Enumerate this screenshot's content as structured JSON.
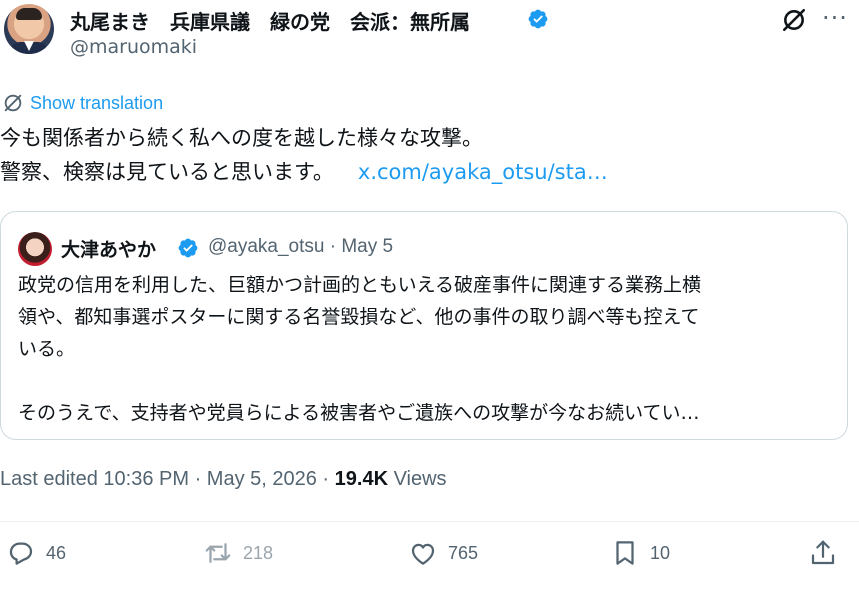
{
  "author": {
    "name": "丸尾まき　兵庫県議　緑の党　会派：無所属",
    "handle": "@maruomaki"
  },
  "translate_label": "Show translation",
  "tweet": {
    "line1": "今も関係者から続く私への度を越した様々な攻撃。",
    "line2": "警察、検察は見ていると思います。",
    "link": "x.com/ayaka_otsu/sta…"
  },
  "quote": {
    "name": "大津あやか",
    "handle": "@ayaka_otsu",
    "separator": "·",
    "date": "May 5",
    "lines": [
      "政党の信用を利用した、巨額かつ計画的ともいえる破産事件に関連する業務上横",
      "領や、都知事選ポスターに関する名誉毀損など、他の事件の取り調べ等も控えて",
      "いる。",
      "",
      "そのうえで、支持者や党員らによる被害者やご遺族への攻撃が今なお続いてい…"
    ]
  },
  "meta": {
    "edited": "Last edited 10:36 PM · May 5, 2026 · ",
    "views_count": "19.4K",
    "views_label": " Views"
  },
  "actions": {
    "replies": "46",
    "reposts": "218",
    "likes": "765",
    "bookmarks": "10"
  },
  "colors": {
    "accent": "#1d9bf0",
    "text": "#0f1419",
    "secondary": "#536471",
    "border": "#cfd9de"
  },
  "icons": [
    "verified-badge-icon",
    "grok-icon",
    "more-icon",
    "translate-icon",
    "reply-icon",
    "repost-icon",
    "like-icon",
    "bookmark-icon",
    "share-icon"
  ]
}
